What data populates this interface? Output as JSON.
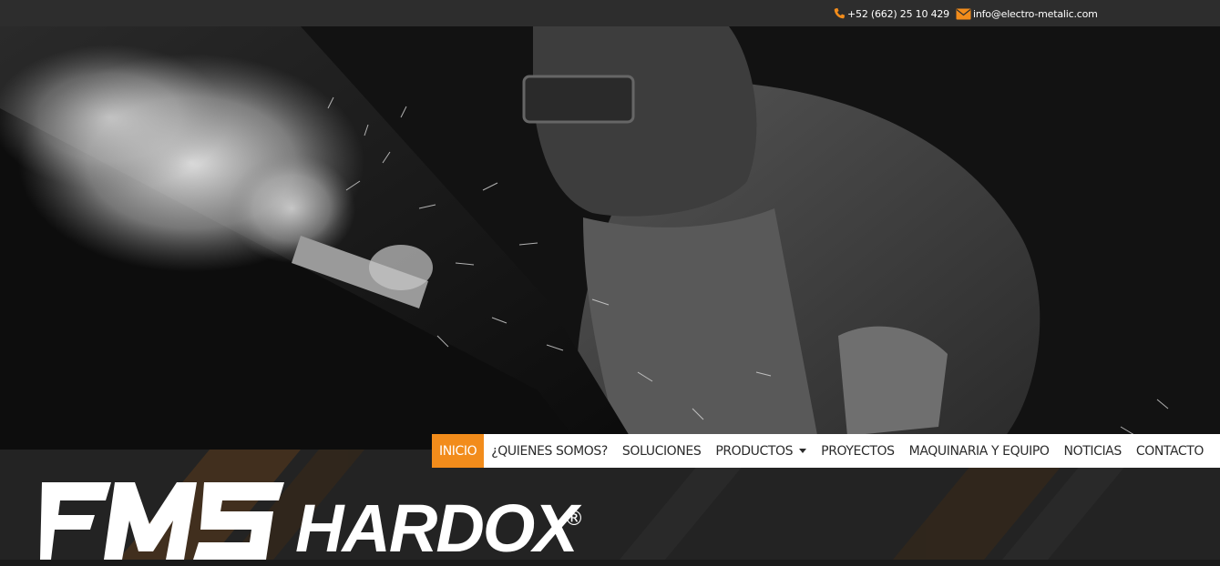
{
  "topbar": {
    "phone": "+52 (662) 25 10 429",
    "email": "info@electro-metalic.com",
    "phone_icon": "phone-icon",
    "email_icon": "envelope-icon",
    "icon_color": "#f28c1b"
  },
  "nav": {
    "active_color": "#f28c1b",
    "items": [
      {
        "label": "INICIO"
      },
      {
        "label": "¿QUIENES SOMOS?"
      },
      {
        "label": "SOLUCIONES"
      },
      {
        "label": "PRODUCTOS"
      },
      {
        "label": "PROYECTOS"
      },
      {
        "label": "MAQUINARIA Y EQUIPO"
      },
      {
        "label": "NOTICIAS"
      },
      {
        "label": "CONTACTO"
      }
    ]
  },
  "brand": {
    "logo": "EMS",
    "partner": "HARDOX",
    "registered": "®"
  }
}
